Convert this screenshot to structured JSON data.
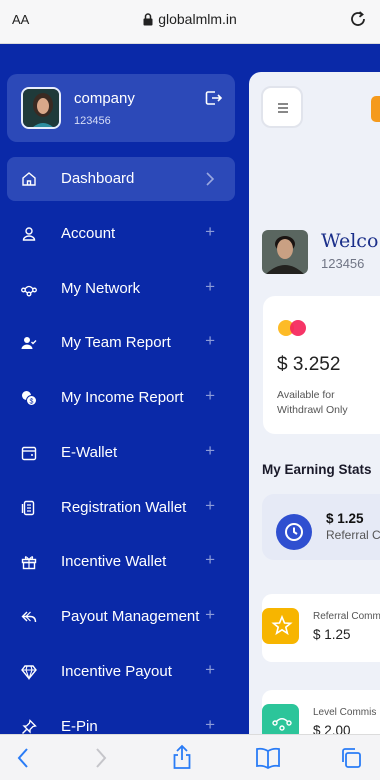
{
  "browser": {
    "text_size_label": "AA",
    "url": "globalmlm.in"
  },
  "profile": {
    "name": "company",
    "id": "123456"
  },
  "menu": {
    "items": [
      {
        "label": "Dashboard",
        "icon": "home-icon",
        "active": true
      },
      {
        "label": "Account",
        "icon": "user-icon"
      },
      {
        "label": "My Network",
        "icon": "network-icon"
      },
      {
        "label": "My Team Report",
        "icon": "user-check-icon"
      },
      {
        "label": "My Income Report",
        "icon": "coins-icon"
      },
      {
        "label": "E-Wallet",
        "icon": "wallet-icon"
      },
      {
        "label": "Registration Wallet",
        "icon": "copy-icon"
      },
      {
        "label": "Incentive Wallet",
        "icon": "gift-icon"
      },
      {
        "label": "Payout Management",
        "icon": "reply-icon"
      },
      {
        "label": "Incentive Payout",
        "icon": "diamond-icon"
      },
      {
        "label": "E-Pin",
        "icon": "pin-icon"
      }
    ],
    "expand_symbol": "+"
  },
  "main": {
    "welcome": "Welco",
    "user_id": "123456",
    "balance_card": {
      "amount": "$ 3.252",
      "caption_line1": "Available for",
      "caption_line2": "Withdrawl Only"
    },
    "stats_title": "My Earning Stats",
    "stat_highlight": {
      "value": "$ 1.25",
      "label": "Referral C"
    },
    "mini_cards": [
      {
        "label": "Referral Comm",
        "value": "$ 1.25",
        "color": "#f7b500",
        "icon": "star-icon"
      },
      {
        "label": "Level Commis",
        "value": "$ 2.00",
        "color": "#2cc59a",
        "icon": "network-icon"
      }
    ]
  },
  "colors": {
    "sidebar_bg": "#0a29a8",
    "active_item_bg": "#2c49b8",
    "accent_blue": "#2f4fd0"
  }
}
